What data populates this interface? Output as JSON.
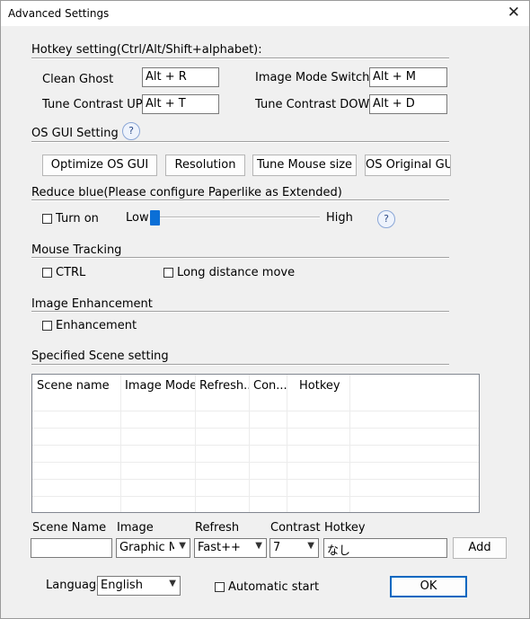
{
  "window": {
    "title": "Advanced Settings",
    "close_glyph": "✕"
  },
  "hotkey": {
    "section": "Hotkey setting(Ctrl/Alt/Shift+alphabet):",
    "clean_ghost_label": "Clean Ghost",
    "clean_ghost_value": "Alt + R",
    "image_mode_label": "Image Mode Switch:",
    "image_mode_value": "Alt + M",
    "contrast_up_label": "Tune Contrast UP:",
    "contrast_up_value": "Alt + T",
    "contrast_down_label": "Tune Contrast DOWN:",
    "contrast_down_value": "Alt + D"
  },
  "os_gui": {
    "section": "OS GUI Setting",
    "help": "?",
    "buttons": [
      "Optimize OS GUI",
      "Resolution",
      "Tune Mouse size",
      "OS Original GUI"
    ]
  },
  "reduce_blue": {
    "section": "Reduce blue(Please configure Paperlike as Extended)",
    "turn_on": "Turn on",
    "checked": false,
    "low": "Low",
    "high": "High",
    "level": 0,
    "help": "?"
  },
  "mouse_tracking": {
    "section": "Mouse Tracking",
    "ctrl": "CTRL",
    "ctrl_checked": false,
    "long_distance": "Long distance move",
    "long_distance_checked": false
  },
  "image_enhancement": {
    "section": "Image Enhancement",
    "enhancement": "Enhancement",
    "checked": false
  },
  "scene": {
    "section": "Specified Scene setting",
    "columns": [
      "Scene name",
      "Image Mode",
      "Refresh...",
      "Con...",
      "Hotkey"
    ],
    "rows": []
  },
  "form": {
    "scene_name_label": "Scene Name",
    "scene_name_value": "",
    "image_label": "Image",
    "image_value": "Graphic Mode",
    "refresh_label": "Refresh",
    "refresh_value": "Fast++",
    "contrast_label": "Contrast",
    "contrast_value": "7",
    "hotkey_label": "Hotkey",
    "hotkey_value": "なし",
    "add": "Add"
  },
  "bottom": {
    "language_label": "Language",
    "language_value": "English",
    "auto_start": "Automatic start",
    "auto_start_checked": false,
    "ok": "OK"
  },
  "colors": {
    "accent": "#0b6fd6",
    "dialog_bg": "#f0f0f0"
  }
}
